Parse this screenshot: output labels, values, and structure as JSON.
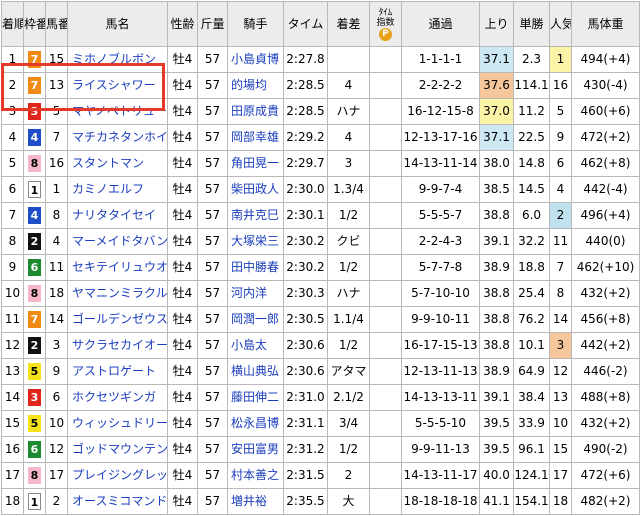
{
  "headers": {
    "rank": "着順",
    "frame": "枠番",
    "num": "馬番",
    "name": "馬名",
    "sexage": "性齢",
    "weight": "斤量",
    "jockey": "騎手",
    "time": "タイム",
    "margin": "着差",
    "index_line1": "ﾀｲﾑ",
    "index_line2": "指数",
    "index_badge": "P",
    "pass": "通過",
    "last": "上り",
    "odds": "単勝",
    "pop": "人気",
    "bodyweight": "馬体重"
  },
  "colors": {
    "frame1": "#ffffff",
    "frame2": "#111111",
    "frame3": "#e0261b",
    "frame4": "#1f4fc7",
    "frame5": "#f5e21a",
    "frame6": "#1c8a2e",
    "frame7": "#f08a12",
    "frame8": "#f6b8c8",
    "highlight_border": "#e43a2b"
  },
  "rows": [
    {
      "rank": "1",
      "frame": "7",
      "num": "15",
      "name": "ミホノブルボン",
      "sexage": "牡4",
      "weight": "57",
      "jockey": "小島貞博",
      "time": "2:27.8",
      "margin": "",
      "pass": "1-1-1-1",
      "last": "37.1",
      "odds": "2.3",
      "pop": "1",
      "bodyweight": "494(+4)",
      "last_hl": "blue",
      "pop_hl": "yellow"
    },
    {
      "rank": "2",
      "frame": "7",
      "num": "13",
      "name": "ライスシャワー",
      "sexage": "牡4",
      "weight": "57",
      "jockey": "的場均",
      "time": "2:28.5",
      "margin": "4",
      "pass": "2-2-2-2",
      "last": "37.6",
      "odds": "114.1",
      "pop": "16",
      "bodyweight": "430(-4)",
      "last_hl": "orange",
      "pop_hl": ""
    },
    {
      "rank": "3",
      "frame": "3",
      "num": "5",
      "name": "マヤノペトリュース",
      "sexage": "牡4",
      "weight": "57",
      "jockey": "田原成貴",
      "time": "2:28.5",
      "margin": "ハナ",
      "pass": "16-12-15-8",
      "last": "37.0",
      "odds": "11.2",
      "pop": "5",
      "bodyweight": "460(+6)",
      "last_hl": "yellow",
      "pop_hl": ""
    },
    {
      "rank": "4",
      "frame": "4",
      "num": "7",
      "name": "マチカネタンホイザ",
      "sexage": "牡4",
      "weight": "57",
      "jockey": "岡部幸雄",
      "time": "2:29.2",
      "margin": "4",
      "pass": "12-13-17-16",
      "last": "37.1",
      "odds": "22.5",
      "pop": "9",
      "bodyweight": "472(+2)",
      "last_hl": "blue",
      "pop_hl": ""
    },
    {
      "rank": "5",
      "frame": "8",
      "num": "16",
      "name": "スタントマン",
      "sexage": "牡4",
      "weight": "57",
      "jockey": "角田晃一",
      "time": "2:29.7",
      "margin": "3",
      "pass": "14-13-11-14",
      "last": "38.0",
      "odds": "14.8",
      "pop": "6",
      "bodyweight": "462(+8)",
      "last_hl": "",
      "pop_hl": ""
    },
    {
      "rank": "6",
      "frame": "1",
      "num": "1",
      "name": "カミノエルフ",
      "sexage": "牡4",
      "weight": "57",
      "jockey": "柴田政人",
      "time": "2:30.0",
      "margin": "1.3/4",
      "pass": "9-9-7-4",
      "last": "38.5",
      "odds": "14.5",
      "pop": "4",
      "bodyweight": "442(-4)",
      "last_hl": "",
      "pop_hl": ""
    },
    {
      "rank": "7",
      "frame": "4",
      "num": "8",
      "name": "ナリタタイセイ",
      "sexage": "牡4",
      "weight": "57",
      "jockey": "南井克巳",
      "time": "2:30.1",
      "margin": "1/2",
      "pass": "5-5-5-7",
      "last": "38.8",
      "odds": "6.0",
      "pop": "2",
      "bodyweight": "496(+4)",
      "last_hl": "",
      "pop_hl": "pblue"
    },
    {
      "rank": "8",
      "frame": "2",
      "num": "4",
      "name": "マーメイドタバン",
      "sexage": "牡4",
      "weight": "57",
      "jockey": "大塚栄三",
      "time": "2:30.2",
      "margin": "クビ",
      "pass": "2-2-4-3",
      "last": "39.1",
      "odds": "32.2",
      "pop": "11",
      "bodyweight": "440(0)",
      "last_hl": "",
      "pop_hl": ""
    },
    {
      "rank": "9",
      "frame": "6",
      "num": "11",
      "name": "セキテイリュウオー",
      "sexage": "牡4",
      "weight": "57",
      "jockey": "田中勝春",
      "time": "2:30.2",
      "margin": "1/2",
      "pass": "5-7-7-8",
      "last": "38.9",
      "odds": "18.8",
      "pop": "7",
      "bodyweight": "462(+10)",
      "last_hl": "",
      "pop_hl": ""
    },
    {
      "rank": "10",
      "frame": "8",
      "num": "18",
      "name": "ヤマニンミラクル",
      "sexage": "牡4",
      "weight": "57",
      "jockey": "河内洋",
      "time": "2:30.3",
      "margin": "ハナ",
      "pass": "5-7-10-10",
      "last": "38.8",
      "odds": "25.4",
      "pop": "8",
      "bodyweight": "432(+2)",
      "last_hl": "",
      "pop_hl": ""
    },
    {
      "rank": "11",
      "frame": "7",
      "num": "14",
      "name": "ゴールデンゼウス",
      "sexage": "牡4",
      "weight": "57",
      "jockey": "岡潤一郎",
      "time": "2:30.5",
      "margin": "1.1/4",
      "pass": "9-9-10-11",
      "last": "38.8",
      "odds": "76.2",
      "pop": "14",
      "bodyweight": "456(+8)",
      "last_hl": "",
      "pop_hl": ""
    },
    {
      "rank": "12",
      "frame": "2",
      "num": "3",
      "name": "サクラセカイオー",
      "sexage": "牡4",
      "weight": "57",
      "jockey": "小島太",
      "time": "2:30.6",
      "margin": "1/2",
      "pass": "16-17-15-13",
      "last": "38.8",
      "odds": "10.1",
      "pop": "3",
      "bodyweight": "442(+2)",
      "last_hl": "",
      "pop_hl": "orange"
    },
    {
      "rank": "13",
      "frame": "5",
      "num": "9",
      "name": "アストロゲート",
      "sexage": "牡4",
      "weight": "57",
      "jockey": "横山典弘",
      "time": "2:30.6",
      "margin": "アタマ",
      "pass": "12-13-11-13",
      "last": "38.9",
      "odds": "64.9",
      "pop": "12",
      "bodyweight": "446(-2)",
      "last_hl": "",
      "pop_hl": ""
    },
    {
      "rank": "14",
      "frame": "3",
      "num": "6",
      "name": "ホクセツギンガ",
      "sexage": "牡4",
      "weight": "57",
      "jockey": "藤田伸二",
      "time": "2:31.0",
      "margin": "2.1/2",
      "pass": "14-13-13-11",
      "last": "39.1",
      "odds": "38.4",
      "pop": "13",
      "bodyweight": "488(+8)",
      "last_hl": "",
      "pop_hl": ""
    },
    {
      "rank": "15",
      "frame": "5",
      "num": "10",
      "name": "ウィッシュドリーム",
      "sexage": "牡4",
      "weight": "57",
      "jockey": "松永昌博",
      "time": "2:31.1",
      "margin": "3/4",
      "pass": "5-5-5-10",
      "last": "39.5",
      "odds": "33.9",
      "pop": "10",
      "bodyweight": "432(+2)",
      "last_hl": "",
      "pop_hl": ""
    },
    {
      "rank": "16",
      "frame": "6",
      "num": "12",
      "name": "ゴッドマウンテン",
      "sexage": "牡4",
      "weight": "57",
      "jockey": "安田富男",
      "time": "2:31.2",
      "margin": "1/2",
      "pass": "9-9-11-13",
      "last": "39.5",
      "odds": "96.1",
      "pop": "15",
      "bodyweight": "490(-2)",
      "last_hl": "",
      "pop_hl": ""
    },
    {
      "rank": "17",
      "frame": "8",
      "num": "17",
      "name": "プレイジングレッド",
      "sexage": "牡4",
      "weight": "57",
      "jockey": "村本善之",
      "time": "2:31.5",
      "margin": "2",
      "pass": "14-13-11-17",
      "last": "40.0",
      "odds": "124.1",
      "pop": "17",
      "bodyweight": "472(+6)",
      "last_hl": "",
      "pop_hl": ""
    },
    {
      "rank": "18",
      "frame": "1",
      "num": "2",
      "name": "オースミコマンド",
      "sexage": "牡4",
      "weight": "57",
      "jockey": "増井裕",
      "time": "2:35.5",
      "margin": "大",
      "pass": "18-18-18-18",
      "last": "41.1",
      "odds": "154.1",
      "pop": "18",
      "bodyweight": "482(+2)",
      "last_hl": "",
      "pop_hl": ""
    }
  ]
}
